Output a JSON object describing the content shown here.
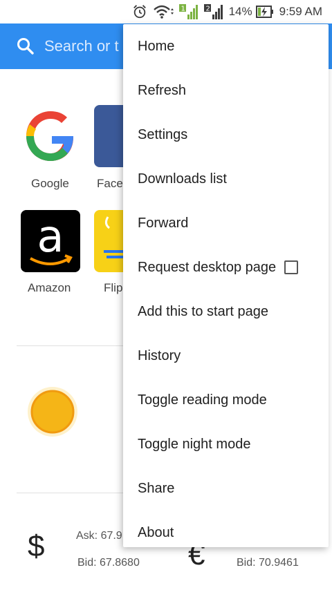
{
  "status_bar": {
    "battery_percent": "14%",
    "time": "9:59 AM",
    "icons": [
      "alarm-icon",
      "wifi-icon",
      "signal-sim1-icon",
      "signal-sim2-icon",
      "battery-charging-icon"
    ],
    "sim1_label": "1",
    "sim2_label": "2"
  },
  "search": {
    "placeholder": "Search or t",
    "icon": "search-icon"
  },
  "speed_dial": [
    {
      "label": "Google"
    },
    {
      "label": "Face"
    },
    {
      "label": "Amazon"
    },
    {
      "label": "Flip"
    }
  ],
  "currency": {
    "usd_ask": "Ask: 67.9",
    "usd_bid": "Bid: 67.8680",
    "eur_bid": "Bid: 70.9461",
    "usd_symbol": "$",
    "eur_symbol": "€"
  },
  "menu": {
    "items": [
      {
        "label": "Home"
      },
      {
        "label": "Refresh"
      },
      {
        "label": "Settings"
      },
      {
        "label": "Downloads list"
      },
      {
        "label": "Forward"
      },
      {
        "label": "Request desktop page",
        "checkbox": false
      },
      {
        "label": "Add this to start page"
      },
      {
        "label": "History"
      },
      {
        "label": "Toggle reading mode"
      },
      {
        "label": "Toggle night mode"
      },
      {
        "label": "Share"
      },
      {
        "label": "About"
      }
    ]
  },
  "colors": {
    "search_bar": "#2f8df0",
    "facebook_tile": "#3b5998",
    "flipkart_tile": "#f7d117",
    "amazon_tile": "#000000",
    "sun": "#f5b517"
  }
}
